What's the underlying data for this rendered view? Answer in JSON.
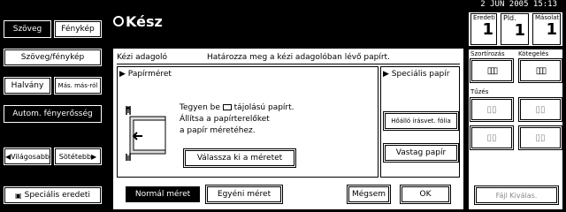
{
  "status": {
    "date_time": "2  JUN   2005 15:13"
  },
  "title": "Kész",
  "left": {
    "text_tab": "Szöveg",
    "photo_tab": "Fénykép",
    "text_photo": "Szöveg/fénykép",
    "pale": "Halvány",
    "generation_copy": "Más. más-ról",
    "auto_density": "Autom. fényerősség",
    "lighter": "Világosabb",
    "darker": "Sötétebb",
    "special_original": "Speciális eredeti"
  },
  "counter": {
    "original_label": "Eredeti",
    "original_value": "1",
    "sets_label": "Pld.",
    "sets_value": "1",
    "copies_label": "Másolat",
    "copies_value": "1"
  },
  "right": {
    "sort_label": "Szortírozás",
    "staple_label": "Kötegelés",
    "punch_label": "Tűzés",
    "file_button": "Fájl Kiválas."
  },
  "dialog": {
    "section": "Kézi adagoló",
    "instruction": "Határozza meg a kézi adagolóban lévő papírt.",
    "paper_size_label": "Papírméret",
    "special_paper_label": "Speciális papír",
    "guide_line1": "Tegyen be",
    "guide_line1_tail": "tájolású papírt.",
    "guide_line2": "Állítsa a papírterelőket",
    "guide_line3": "a papír méretéhez.",
    "select_size_button": "Válassza ki a méretet",
    "ohp_button": "Hőálló írásvet. fólia",
    "thick_button": "Vastag papír",
    "normal_size_button": "Normál méret",
    "custom_size_button": "Egyéni méret",
    "cancel_button": "Mégsem",
    "ok_button": "OK"
  }
}
